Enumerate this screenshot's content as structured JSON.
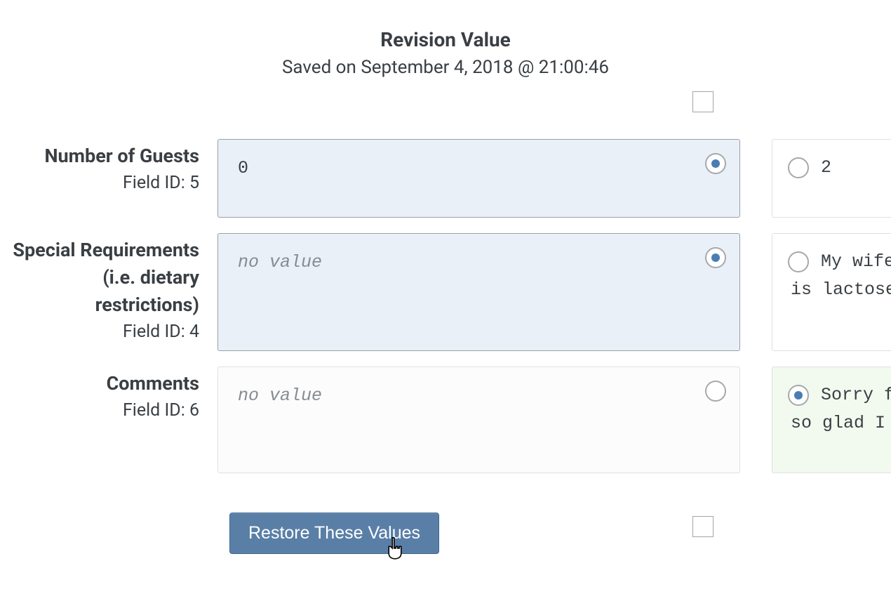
{
  "header": {
    "title": "Revision Value",
    "subtitle": "Saved on September 4, 2018 @ 21:00:46"
  },
  "fields": [
    {
      "label": "Number of Guests",
      "field_id": "Field ID: 5",
      "left_value": "0",
      "left_is_placeholder": false,
      "left_selected": true,
      "right_value_line1": "2",
      "right_value_line2": "",
      "right_selected": false,
      "right_green": false,
      "row_min_height": 112
    },
    {
      "label": "Special Requirements (i.e. dietary restrictions)",
      "field_id": "Field ID: 4",
      "left_value": "no value",
      "left_is_placeholder": true,
      "left_selected": true,
      "right_value_line1": "My wife",
      "right_value_line2": "is lactose",
      "right_selected": false,
      "right_green": false,
      "row_min_height": 168
    },
    {
      "label": "Comments",
      "field_id": "Field ID: 6",
      "left_value": "no value",
      "left_is_placeholder": true,
      "left_selected": false,
      "right_value_line1": "Sorry f",
      "right_value_line2": "so glad I",
      "right_selected": true,
      "right_green": true,
      "row_min_height": 152
    }
  ],
  "restore_button_label": "Restore These Values",
  "placeholder_text": "no value"
}
